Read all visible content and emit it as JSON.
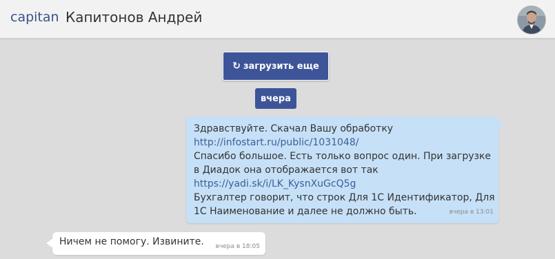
{
  "header": {
    "login": "capitan",
    "full_name": "Капитонов Андрей"
  },
  "load_more": {
    "icon": "refresh-icon",
    "label": "загрузить еще"
  },
  "date_separator": "вчера",
  "messages": [
    {
      "direction": "outgoing",
      "lines": [
        "Здравствуйте. Скачал Вашу обработку",
        "http://infostart.ru/public/1031048/",
        "Спасибо большое. Есть только вопрос один. При загрузке",
        "в Диадок она отображается вот так",
        "https://yadi.sk/i/LK_KysnXuGcQ5g",
        "Бухгалтер говорит, что строк Для 1С Идентификатор, Для",
        "1С Наименование и далее не должно быть."
      ],
      "time": "вчера в 13:01"
    },
    {
      "direction": "incoming",
      "text": "Ничем не помогу. Извините.",
      "time": "вчера в 18:05"
    }
  ],
  "colors": {
    "accent": "#3d5598",
    "outgoing_bubble": "#c6e0f7",
    "incoming_bubble": "#ffffff",
    "link": "#3c5f99",
    "background": "#dcdcdc"
  }
}
